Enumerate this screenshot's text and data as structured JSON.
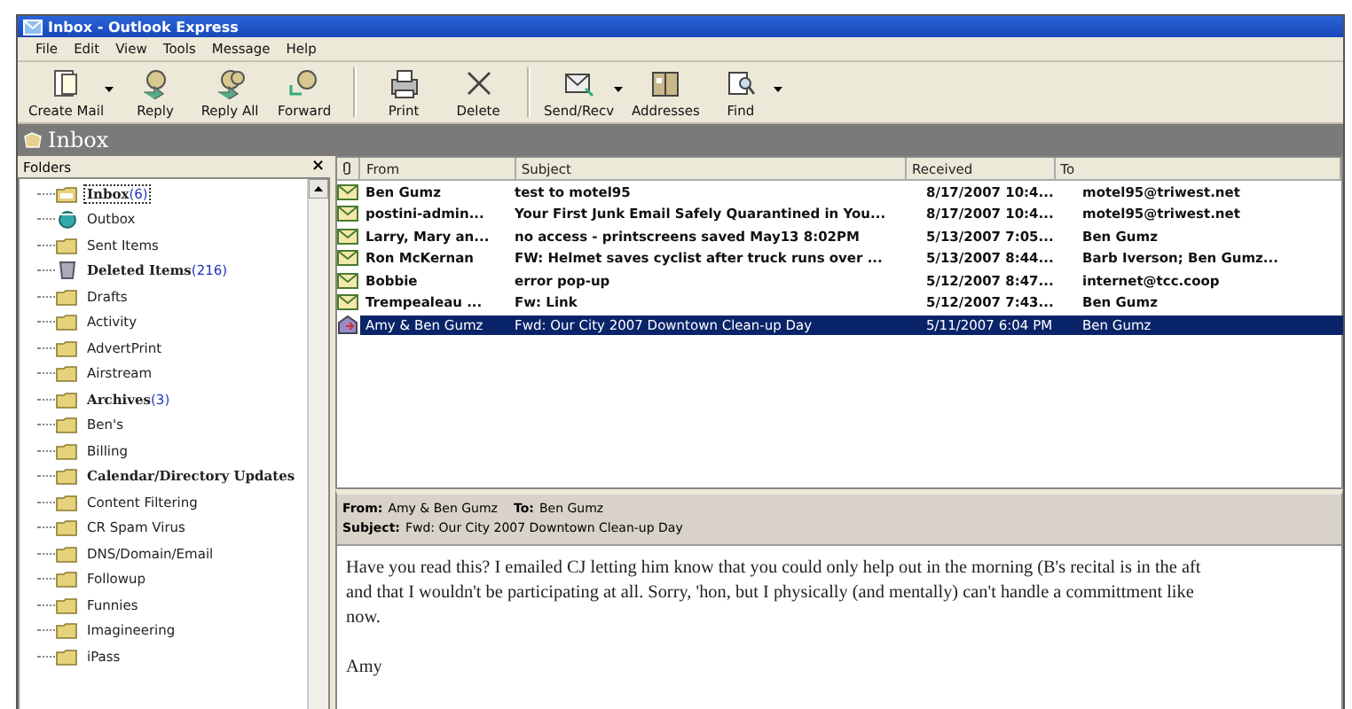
{
  "window": {
    "title": "Inbox - Outlook Express"
  },
  "menu": [
    "File",
    "Edit",
    "View",
    "Tools",
    "Message",
    "Help"
  ],
  "toolbar": [
    {
      "buttons": [
        {
          "label": "Create Mail",
          "kind": "create",
          "dropdown": true
        },
        {
          "label": "Reply",
          "kind": "reply",
          "dropdown": false
        },
        {
          "label": "Reply All",
          "kind": "replyall",
          "dropdown": false
        },
        {
          "label": "Forward",
          "kind": "forward",
          "dropdown": false
        }
      ]
    },
    {
      "buttons": [
        {
          "label": "Print",
          "kind": "print",
          "dropdown": false
        },
        {
          "label": "Delete",
          "kind": "delete",
          "dropdown": false
        }
      ]
    },
    {
      "buttons": [
        {
          "label": "Send/Recv",
          "kind": "sendrecv",
          "dropdown": true
        },
        {
          "label": "Addresses",
          "kind": "addresses",
          "dropdown": false
        },
        {
          "label": "Find",
          "kind": "find",
          "dropdown": true
        }
      ]
    }
  ],
  "folder_header": {
    "title": "Inbox"
  },
  "folders_pane": {
    "title": "Folders",
    "close": "×"
  },
  "folders": [
    {
      "name": "Inbox",
      "count": "(6)",
      "bold": true,
      "selected": true,
      "kind": "inbox"
    },
    {
      "name": "Outbox",
      "bold": false,
      "selected": false,
      "kind": "outbox"
    },
    {
      "name": "Sent Items",
      "bold": false,
      "selected": false,
      "kind": "folder"
    },
    {
      "name": "Deleted Items",
      "count": "(216)",
      "bold": true,
      "selected": false,
      "kind": "trash"
    },
    {
      "name": "Drafts",
      "bold": false,
      "selected": false,
      "kind": "folder"
    },
    {
      "name": "Activity",
      "bold": false,
      "selected": false,
      "kind": "folder"
    },
    {
      "name": "AdvertPrint",
      "bold": false,
      "selected": false,
      "kind": "folder"
    },
    {
      "name": "Airstream",
      "bold": false,
      "selected": false,
      "kind": "folder"
    },
    {
      "name": "Archives",
      "count": "(3)",
      "bold": true,
      "selected": false,
      "kind": "folder"
    },
    {
      "name": "Ben's",
      "bold": false,
      "selected": false,
      "kind": "folder"
    },
    {
      "name": "Billing",
      "bold": false,
      "selected": false,
      "kind": "folder"
    },
    {
      "name": "Calendar/Directory Updates",
      "bold": true,
      "selected": false,
      "kind": "folder"
    },
    {
      "name": "Content Filtering",
      "bold": false,
      "selected": false,
      "kind": "folder"
    },
    {
      "name": "CR Spam Virus",
      "bold": false,
      "selected": false,
      "kind": "folder"
    },
    {
      "name": "DNS/Domain/Email",
      "bold": false,
      "selected": false,
      "kind": "folder"
    },
    {
      "name": "Followup",
      "bold": false,
      "selected": false,
      "kind": "folder"
    },
    {
      "name": "Funnies",
      "bold": false,
      "selected": false,
      "kind": "folder"
    },
    {
      "name": "Imagineering",
      "bold": false,
      "selected": false,
      "kind": "folder"
    },
    {
      "name": "iPass",
      "bold": false,
      "selected": false,
      "kind": "folder"
    }
  ],
  "message_list": {
    "columns": [
      "From",
      "Subject",
      "Received",
      "To"
    ],
    "rows": [
      {
        "from": "Ben Gumz",
        "subject": "test to motel95",
        "received": "8/17/2007 10:4...",
        "to": "motel95@triwest.net",
        "unread": true,
        "selected": false,
        "kind": "mail"
      },
      {
        "from": "postini-admin...",
        "subject": "Your First Junk Email Safely Quarantined in You...",
        "received": "8/17/2007 10:4...",
        "to": "motel95@triwest.net",
        "unread": true,
        "selected": false,
        "kind": "mail"
      },
      {
        "from": "Larry, Mary an...",
        "subject": "no access - printscreens saved May13 8:02PM",
        "received": "5/13/2007 7:05...",
        "to": "Ben Gumz",
        "unread": true,
        "selected": false,
        "kind": "mail"
      },
      {
        "from": "Ron McKernan",
        "subject": "FW: Helmet saves cyclist after truck runs over ...",
        "received": "5/13/2007 8:44...",
        "to": "Barb Iverson; Ben Gumz...",
        "unread": true,
        "selected": false,
        "kind": "mail"
      },
      {
        "from": "Bobbie",
        "subject": "error pop-up",
        "received": "5/12/2007 8:47...",
        "to": "internet@tcc.coop",
        "unread": true,
        "selected": false,
        "kind": "mail"
      },
      {
        "from": "Trempealeau ...",
        "subject": "Fw: Link",
        "received": "5/12/2007 7:43...",
        "to": "Ben Gumz",
        "unread": true,
        "selected": false,
        "kind": "mail"
      },
      {
        "from": "Amy & Ben Gumz",
        "subject": "Fwd: Our City 2007 Downtown Clean-up Day",
        "received": "5/11/2007 6:04 PM",
        "to": "Ben Gumz",
        "unread": false,
        "selected": true,
        "kind": "forwarded"
      }
    ]
  },
  "preview": {
    "from_label": "From:",
    "from": "Amy & Ben Gumz",
    "to_label": "To:",
    "to": "Ben Gumz",
    "subject_label": "Subject:",
    "subject": "Fwd: Our City 2007 Downtown Clean-up Day",
    "body": [
      "Have you read this? I emailed CJ letting him know that you could only help out in the morning (B's recital is in the aft",
      "and that I wouldn't be participating at all. Sorry, 'hon, but I physically (and mentally) can't handle a committment like",
      "now."
    ],
    "signature": "Amy"
  }
}
